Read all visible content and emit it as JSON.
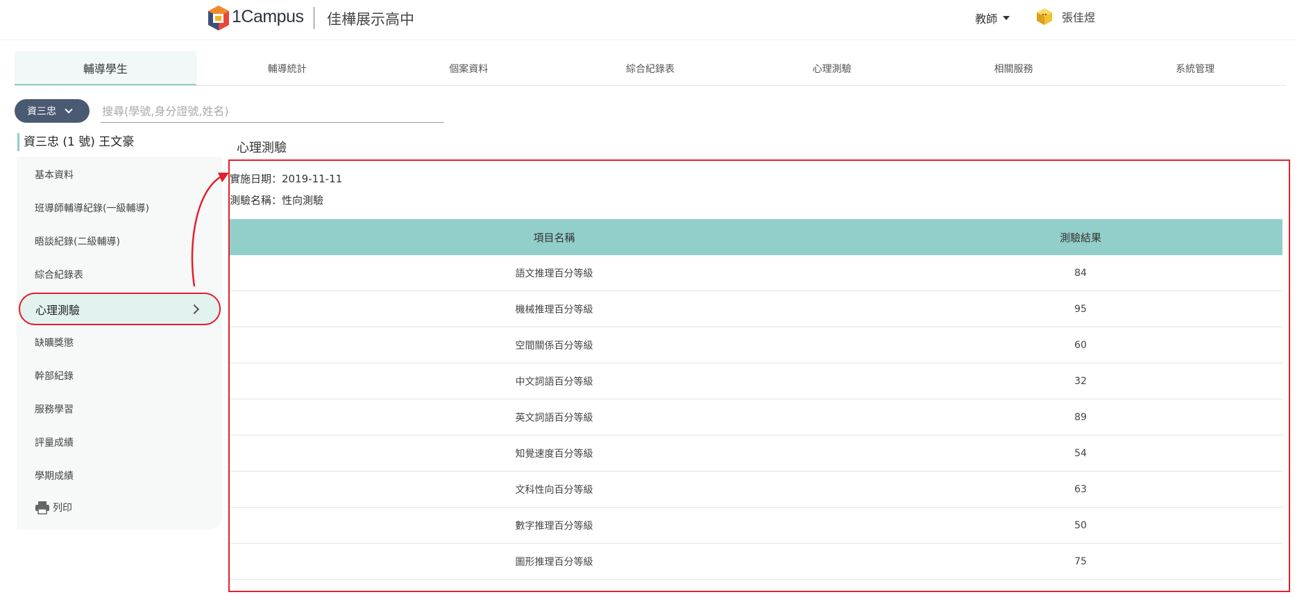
{
  "header": {
    "brand": "1Campus",
    "school": "佳樺展示高中",
    "role": "教師",
    "user": "張佳煜"
  },
  "nav": {
    "tabs": [
      "輔導學生",
      "輔導統計",
      "個案資料",
      "綜合紀錄表",
      "心理測驗",
      "相關服務",
      "系統管理"
    ]
  },
  "filter": {
    "class": "資三忠",
    "search_placeholder": "搜尋(學號,身分證號,姓名)"
  },
  "student": {
    "title": "資三忠 (1 號) 王文豪"
  },
  "sidebar": {
    "items": [
      "基本資料",
      "班導師輔導紀錄(一級輔導)",
      "晤談紀錄(二級輔導)",
      "綜合紀錄表",
      "心理測驗",
      "缺曠獎懲",
      "幹部紀錄",
      "服務學習",
      "評量成績",
      "學期成績",
      "列印"
    ]
  },
  "main": {
    "section_title": "心理測驗",
    "date_line": "實施日期：2019-11-11",
    "name_line": "測驗名稱：性向測驗",
    "table": {
      "headers": [
        "項目名稱",
        "測驗結果"
      ],
      "rows": [
        [
          "語文推理百分等級",
          "84"
        ],
        [
          "機械推理百分等級",
          "95"
        ],
        [
          "空間關係百分等級",
          "60"
        ],
        [
          "中文詞語百分等級",
          "32"
        ],
        [
          "英文詞語百分等級",
          "89"
        ],
        [
          "知覺速度百分等級",
          "54"
        ],
        [
          "文科性向百分等級",
          "63"
        ],
        [
          "數字推理百分等級",
          "50"
        ],
        [
          "圖形推理百分等級",
          "75"
        ]
      ]
    }
  },
  "colors": {
    "accent": "#93cfca",
    "chip": "#4a5a72",
    "annotation": "#e41e2b"
  }
}
